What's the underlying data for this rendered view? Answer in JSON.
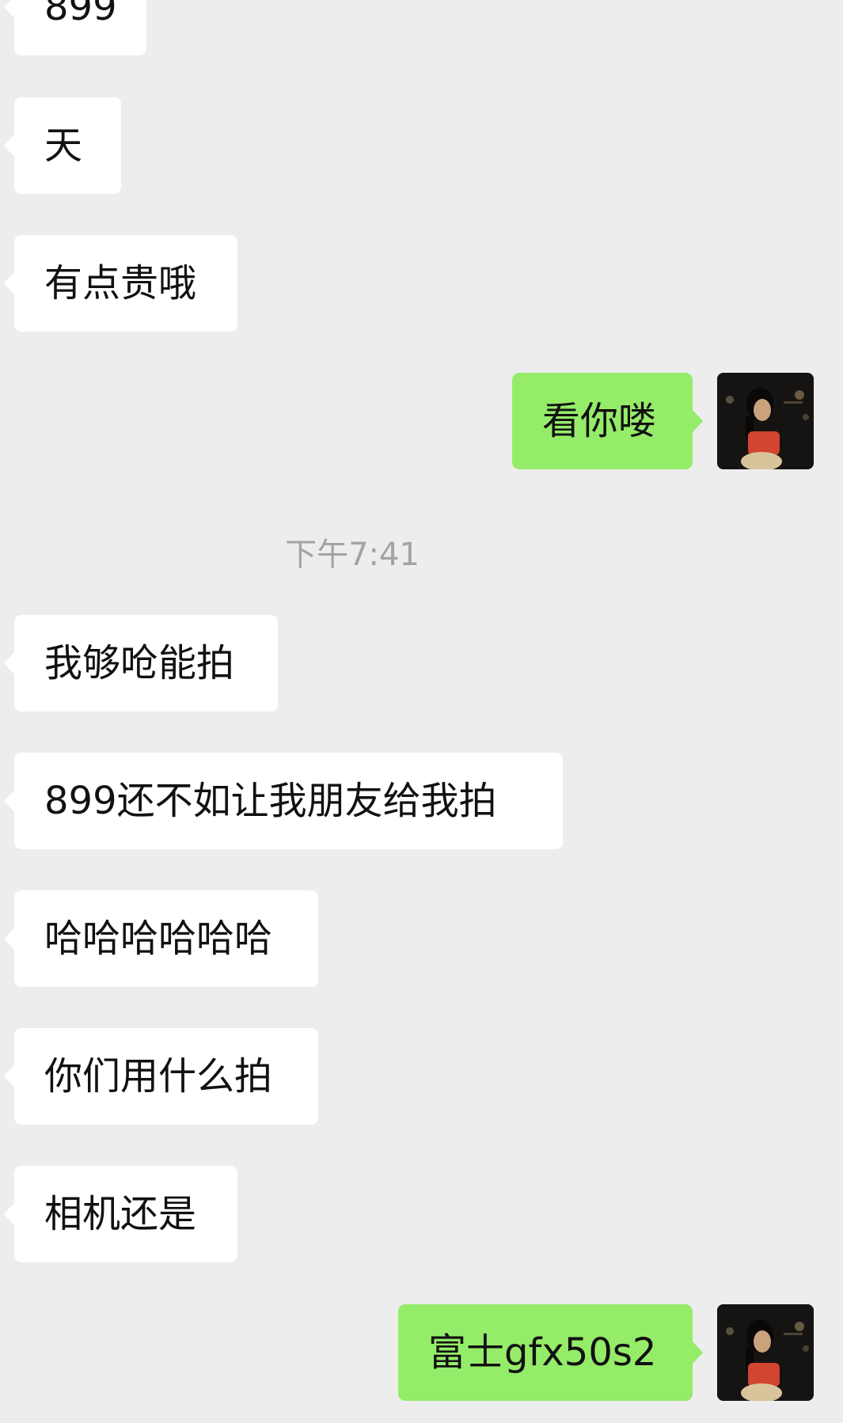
{
  "conversation": {
    "messages": [
      {
        "side": "in",
        "text": "899"
      },
      {
        "side": "in",
        "text": "天"
      },
      {
        "side": "in",
        "text": "有点贵哦"
      },
      {
        "side": "out",
        "text": "看你喽"
      },
      {
        "side": "in",
        "text": "我够呛能拍"
      },
      {
        "side": "in",
        "text": "899还不如让我朋友给我拍"
      },
      {
        "side": "in",
        "text": "哈哈哈哈哈哈"
      },
      {
        "side": "in",
        "text": "你们用什么拍"
      },
      {
        "side": "in",
        "text": "相机还是"
      },
      {
        "side": "out",
        "text": "富士gfx50s2"
      }
    ],
    "timestamp": "下午7:41"
  },
  "colors": {
    "background": "#ededed",
    "incoming_bubble": "#ffffff",
    "outgoing_bubble": "#95ec69",
    "timestamp_text": "#a3a3a3"
  },
  "icons": {
    "user_avatar": "user-avatar-photo"
  }
}
